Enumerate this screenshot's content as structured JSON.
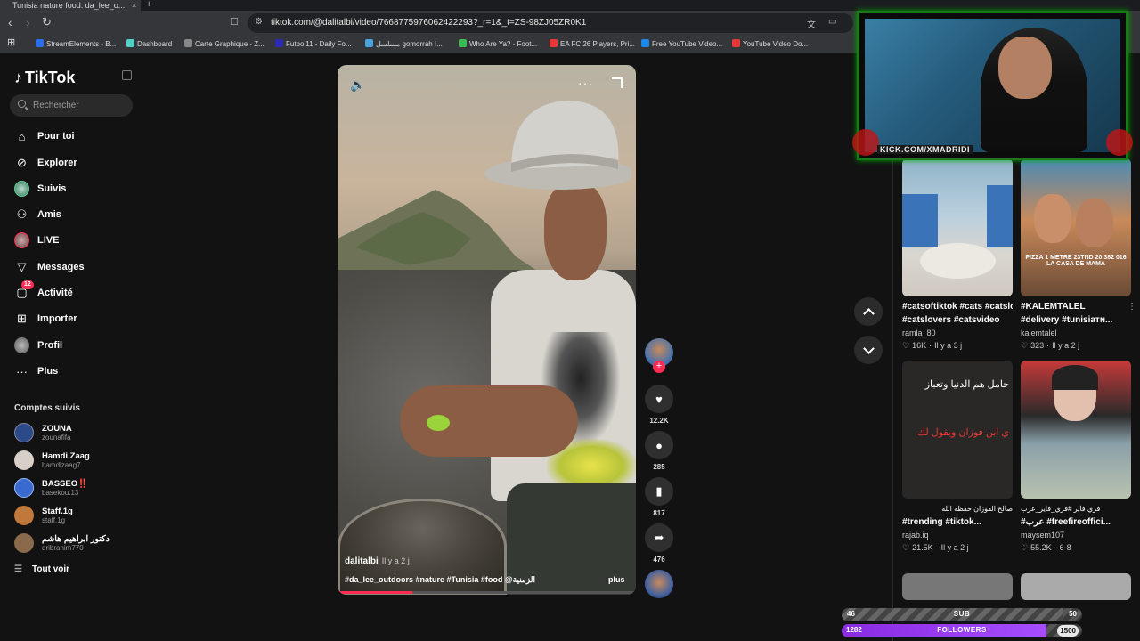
{
  "browser": {
    "tab_title": "Tunisia nature food. da_lee_o...",
    "tab_close": "×",
    "new_tab": "+",
    "url": "tiktok.com/@dalitalbi/video/7668775976062422293?_r=1&_t=ZS-98ZJ05ZR0K1",
    "bookmarks": [
      {
        "label": "StreamElements - B...",
        "color": "#2a6ef0"
      },
      {
        "label": "Dashboard",
        "color": "#4fd1c5"
      },
      {
        "label": "Carte Graphique - Z...",
        "color": "#888888"
      },
      {
        "label": "Futbol11 - Daily Fo...",
        "color": "#2b2bb5"
      },
      {
        "label": "مسلسل gomorrah ا...",
        "color": "#4aa3df"
      },
      {
        "label": "Who Are Ya? - Foot...",
        "color": "#3cba54"
      },
      {
        "label": "EA FC 26 Players, Pri...",
        "color": "#e53935"
      },
      {
        "label": "Free YouTube Video...",
        "color": "#1e88e5"
      },
      {
        "label": "YouTube Video Do...",
        "color": "#e53935"
      }
    ]
  },
  "sidebar": {
    "brand": "TikTok",
    "search_placeholder": "Rechercher",
    "nav": [
      {
        "label": "Pour toi",
        "icon": "home-icon"
      },
      {
        "label": "Explorer",
        "icon": "compass-icon"
      },
      {
        "label": "Suivis",
        "icon": "following-icon"
      },
      {
        "label": "Amis",
        "icon": "friends-icon"
      },
      {
        "label": "LIVE",
        "icon": "live-icon"
      },
      {
        "label": "Messages",
        "icon": "send-icon"
      },
      {
        "label": "Activité",
        "icon": "activity-icon",
        "badge": "12"
      },
      {
        "label": "Importer",
        "icon": "upload-icon"
      },
      {
        "label": "Profil",
        "icon": "profile-icon"
      },
      {
        "label": "Plus",
        "icon": "more-icon"
      }
    ],
    "following_title": "Comptes suivis",
    "accounts": [
      {
        "name": "ZOUNA",
        "handle": "zounafifa",
        "color": "#2a4a8a"
      },
      {
        "name": "Hamdi Zaag",
        "handle": "hamdizaag7",
        "color": "#d8d0c8"
      },
      {
        "name": "BASSEO‼️",
        "handle": "basekou.13",
        "color": "#3a6ad0"
      },
      {
        "name": "Staff.1g",
        "handle": "staff.1g",
        "color": "#c0793a"
      },
      {
        "name": "دكتور ابراهيم هاشم",
        "handle": "dribrahim770",
        "color": "#8a6a4a"
      }
    ],
    "see_all": "Tout voir"
  },
  "video": {
    "author": "dalitalbi",
    "time": "Il y a 2 j",
    "caption": "#da_lee_outdoors #nature #Tunisia #food  @الزمنية",
    "more": "plus",
    "progress": 0.25
  },
  "actions": {
    "likes": "12.2K",
    "comments": "285",
    "saves": "817",
    "shares": "476"
  },
  "grid": [
    {
      "title": "#catsoftiktok #cats #catslovers #catsvideo",
      "title2": "#catslovers #catsvideo",
      "author": "ramla_80",
      "likes": "16K",
      "time": "Il y a 3 j"
    },
    {
      "title": "#KALEMTALEL",
      "title2": "#delivery #tunisiaᴛɴ...",
      "author": "kalemtalel",
      "likes": "323",
      "time": "Il y a 2 j",
      "thumb_text": "PIZZA 1 METRE 23TND 20 382 016 LA CASA DE MAMA"
    },
    {
      "title": "صالح الفوزان حفظه الله",
      "title2": "#trending #tiktok...",
      "author": "rajab.iq",
      "likes": "21.5K",
      "time": "Il y a 2 j",
      "ar1": "حامل هم الدنيا وتعباز",
      "ar2": "ي ابن فوزان ويقول لك"
    },
    {
      "title": "فري فاير #فري_فاير_عرب",
      "title2": "#عرب #freefireoffici...",
      "author": "maysem107",
      "likes": "55.2K",
      "time": "6-8"
    }
  ],
  "overlay": {
    "cam_label": "KICK.COM/XMADRIDI",
    "sub_current": "46",
    "sub_label": "SUB",
    "sub_goal": "50",
    "sub_progress": 0.92,
    "followers_current": "1282",
    "followers_label": "FOLLOWERS",
    "followers_goal": "1500",
    "followers_progress": 0.85
  },
  "colors": {
    "accent": "#fe2c55",
    "live_purple": "#9b30ff"
  }
}
